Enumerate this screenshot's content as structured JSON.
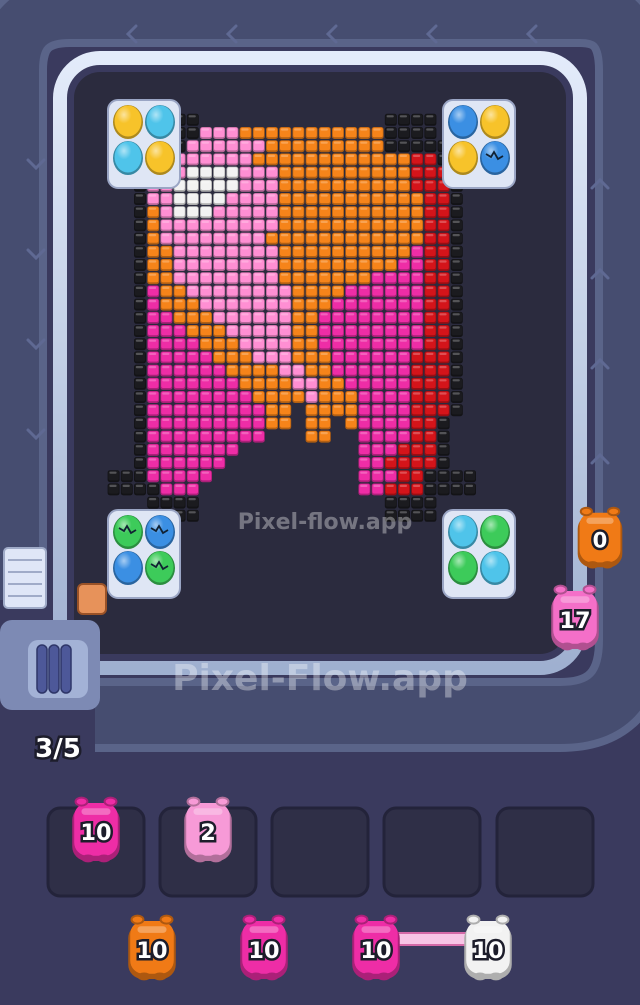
{
  "watermark": {
    "upper": "Pixel-flow.app",
    "lower": "Pixel-Flow.app"
  },
  "queue_counter": "3/5",
  "active_shooters": [
    {
      "count": "0",
      "color": "#f07a16"
    },
    {
      "count": "17",
      "color": "#f46fc8"
    }
  ],
  "held_slots": [
    {
      "count": "10",
      "color": "#ee2da6"
    },
    {
      "count": "2",
      "color": "#f79ad7"
    },
    {
      "count": null
    },
    {
      "count": null
    },
    {
      "count": null
    }
  ],
  "waiting_row": [
    {
      "count": "10",
      "color": "#f07a16"
    },
    {
      "count": "10",
      "color": "#ee2da6"
    },
    {
      "count": "10",
      "color": "#ee2da6"
    },
    {
      "count": "10",
      "color": "#f2f2f2"
    }
  ],
  "colors": {
    "board_bg": "#2b2b3e",
    "belt": "#c9d6ee",
    "pink": "#ff8fd3",
    "hot_pink": "#ee2da6",
    "orange": "#f6841a",
    "red": "#d4141a",
    "white": "#f2f2f2",
    "frame": "#1b1b1f"
  },
  "pixel_art": {
    "palette": {
      "K": "#1b1b1f",
      "W": "#f2f2f2",
      "L": "#ff8fd3",
      "P": "#ee2da6",
      "O": "#f6841a",
      "R": "#d4141a",
      ".": null
    },
    "rows": [
      "..............................",
      "...KKKK..............KKKK.....",
      "...KKKKLLLOOOOOOOOOOOKKKK.....",
      "KKKKKKLLLLLLOOOOOOOOOKKKKKKKK.",
      "KKKLLLLLLLLOOOOOOOOOOOORRKKKK.",
      "..KLLLWWWWLLLOOOOOOOOOORRRK...",
      "..KLLWWWWWLLLOOOOOOOOOORRRK...",
      "..KLLWWWWLLLLOOOOOOOOOOORRK...",
      "..KOLWWWLLLLLOOOOOOOOOOORRK...",
      "..KOLLLLLLLLLOOOOOOOOOOORRK...",
      "..KOLLLLLLLLOOOOOOOOOOOORRK...",
      "..KOOLLLLLLLLOOOOOOOOOOPRRK...",
      "..KOOLLLLLLLLOOOOOOOOOPPRRK...",
      "..KOOLLLLLLLLOOOOOOOPPPPRRK...",
      "..KPOOLLLLLLLLOOOOPPPPPPRRK...",
      "..KPOOOLLLLLLLOOOPPPPPPPRRK...",
      "..KPPOOOLLLLLLOOPPPPPPPPRRK...",
      "..KPPPOOOLLLLLOOPPPPPPPPRRK...",
      "..KPPPPOOOLLLLOOPPPPPPPPRRK...",
      "..KPPPPPOOOLLLOOOPPPPPPRRRK...",
      "..KPPPPPPOOOOLLOOPPPPPPRRRK...",
      "..KPPPPPPPOOOOLLOOPPPPPRRRK...",
      "..KPPPPPPPPOOOOLOOOPPPPRRRK...",
      "..KPPPPPPPPPOO.OOOOPPPPRRRK...",
      "..KPPPPPPPPPOO.OO.OPPPPRRK....",
      "..KPPPPPPPPP...OO..PPPPRRK....",
      "..KPPPPPPP.........PPPRRRK....",
      "..KPPPPPP..........PPRRRRK....",
      "KKKPPPPP...........PPPRRKKKK..",
      "KKKKPPP............PPRRRKKKK..",
      "...KKKK..............KKKK.....",
      "...KKKK..............KKKK....."
    ]
  },
  "egg_trays": [
    {
      "eggs": [
        "#f7c32a",
        "#4fc4ea",
        "#4fc4ea",
        "#f7c32a"
      ],
      "cracked": [
        false,
        false,
        false,
        false
      ]
    },
    {
      "eggs": [
        "#3b8fe3",
        "#f7c32a",
        "#f7c32a",
        "#3b8fe3"
      ],
      "cracked": [
        false,
        false,
        false,
        true
      ]
    },
    {
      "eggs": [
        "#3dcb5a",
        "#3b8fe3",
        "#3b8fe3",
        "#3dcb5a"
      ],
      "cracked": [
        true,
        true,
        false,
        true
      ]
    },
    {
      "eggs": [
        "#4fc4ea",
        "#3dcb5a",
        "#3dcb5a",
        "#4fc4ea"
      ],
      "cracked": [
        false,
        false,
        false,
        false
      ]
    }
  ]
}
